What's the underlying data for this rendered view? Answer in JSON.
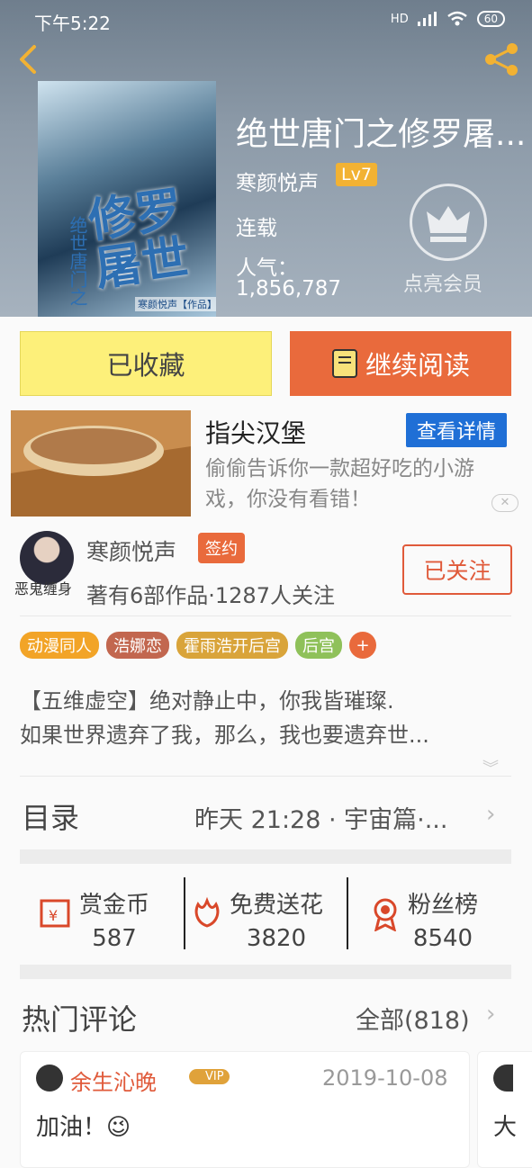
{
  "status_bar": {
    "time": "下午5:22",
    "network": "HD",
    "battery": "60"
  },
  "book": {
    "title": "绝世唐门之修罗屠...",
    "author": "寒颜悦声",
    "level": "Lv7",
    "status": "连载",
    "popularity_label": "人气：",
    "popularity_value": "1,856,787",
    "cover_title": "修罗屠世",
    "cover_subtitle": "绝世唐门之",
    "cover_author": "寒颜悦声【作品】"
  },
  "vip": {
    "label": "点亮会员"
  },
  "actions": {
    "favorited": "已收藏",
    "continue_reading": "继续阅读"
  },
  "ad": {
    "title": "指尖汉堡",
    "button": "查看详情",
    "desc": "偷偷告诉你一款超好吃的小游戏，你没有看错！",
    "close": "✕"
  },
  "author_info": {
    "name": "寒颜悦声",
    "badge": "签约",
    "stats": "著有6部作品·1287人关注",
    "follow": "已关注",
    "avatar_tag": "恶鬼缠身"
  },
  "tags": [
    {
      "label": "动漫同人",
      "color": "#f2a427"
    },
    {
      "label": "浩娜恋",
      "color": "#c2674f"
    },
    {
      "label": "霍雨浩开后宫",
      "color": "#d9a43a"
    },
    {
      "label": "后宫",
      "color": "#8fc15a"
    },
    {
      "label": "+",
      "color": "#e96a3c"
    }
  ],
  "description": {
    "line1": "【五维虚空】绝对静止中，你我皆璀璨.",
    "line2": "如果世界遗弃了我，那么，我也要遗弃世..."
  },
  "toc": {
    "label": "目录",
    "latest": "昨天 21:28 · 宇宙篇·..."
  },
  "stats": [
    {
      "label": "赏金币",
      "value": "587"
    },
    {
      "label": "免费送花",
      "value": "3820"
    },
    {
      "label": "粉丝榜",
      "value": "8540"
    }
  ],
  "comments": {
    "title": "热门评论",
    "all": "全部(818)",
    "items": [
      {
        "user": "余生沁晚",
        "vip": "VIP",
        "date": "2019-10-08",
        "text": "加油！😉"
      },
      {
        "text": "大"
      }
    ]
  }
}
